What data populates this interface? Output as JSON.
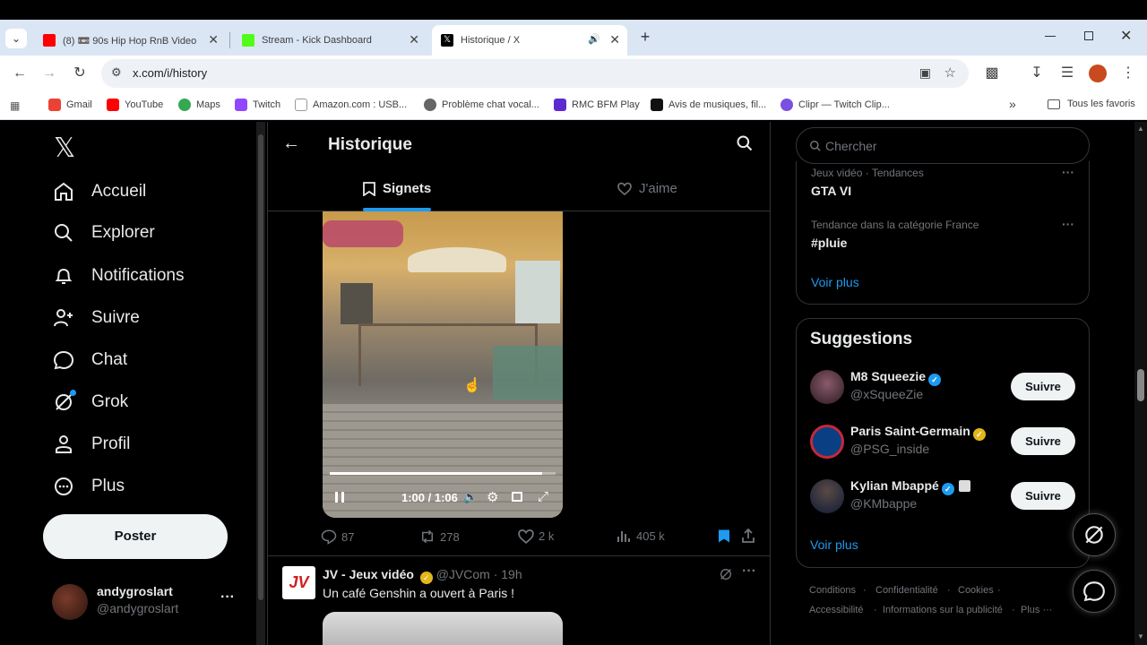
{
  "browser": {
    "tabs": [
      {
        "title": "(8) 📼 90s Hip Hop RnB Video",
        "close": "✕"
      },
      {
        "title": "Stream - Kick Dashboard",
        "close": "✕"
      },
      {
        "title": "Historique / X",
        "close": "✕"
      }
    ],
    "new_tab": "+",
    "url": "x.com/i/history",
    "bookmarks": [
      {
        "label": "Gmail",
        "color": "#ea4335"
      },
      {
        "label": "YouTube",
        "color": "#ff0000"
      },
      {
        "label": "Maps",
        "color": "#34a853"
      },
      {
        "label": "Twitch",
        "color": "#9146ff"
      },
      {
        "label": "Amazon.com : USB...",
        "color": "#222222"
      },
      {
        "label": "Problème chat vocal...",
        "color": "#555555"
      },
      {
        "label": "RMC BFM Play",
        "color": "#5b2bd1"
      },
      {
        "label": "Avis de musiques, fil...",
        "color": "#111111"
      },
      {
        "label": "Clipr — Twitch Clip...",
        "color": "#7b4fe0"
      }
    ],
    "bookmarks_more": "»",
    "all_bookmarks": "Tous les favoris"
  },
  "nav": {
    "items": [
      {
        "label": "Accueil",
        "icon": "home-icon"
      },
      {
        "label": "Explorer",
        "icon": "search-icon"
      },
      {
        "label": "Notifications",
        "icon": "bell-icon"
      },
      {
        "label": "Suivre",
        "icon": "person-add-icon"
      },
      {
        "label": "Chat",
        "icon": "chat-icon"
      },
      {
        "label": "Grok",
        "icon": "grok-icon"
      },
      {
        "label": "Profil",
        "icon": "profile-icon"
      },
      {
        "label": "Plus",
        "icon": "more-icon"
      }
    ],
    "post_button": "Poster",
    "account": {
      "name": "andygroslart",
      "handle": "@andygroslart",
      "more": "···"
    }
  },
  "main": {
    "title": "Historique",
    "tabs": [
      {
        "label": "Signets",
        "active": true
      },
      {
        "label": "J'aime",
        "active": false
      }
    ],
    "video": {
      "time": "1:00 / 1:06",
      "progress": 0.94
    },
    "actions": {
      "replies": "87",
      "reposts": "278",
      "likes": "2 k",
      "views": "405 k"
    },
    "next_post": {
      "author": "JV - Jeux vidéo",
      "handle": "@JVCom",
      "time": "· 19h",
      "text": "Un café Genshin a ouvert à Paris !",
      "avatar_text": "JV"
    }
  },
  "side": {
    "search_placeholder": "Chercher",
    "trends": [
      {
        "context": "Jeux vidéo · Tendances",
        "name": "GTA VI"
      },
      {
        "context": "Tendance dans la catégorie France",
        "name": "#pluie"
      }
    ],
    "trends_more": "Voir plus",
    "suggestions_title": "Suggestions",
    "suggestions": [
      {
        "name": "M8 Squeezie",
        "handle": "@xSqueeZie",
        "button": "Suivre",
        "badge": "blue"
      },
      {
        "name": "Paris Saint-Germain",
        "handle": "@PSG_inside",
        "button": "Suivre",
        "badge": "gold"
      },
      {
        "name": "Kylian Mbappé",
        "handle": "@KMbappe",
        "button": "Suivre",
        "badge": "blue"
      }
    ],
    "suggestions_more": "Voir plus",
    "footer": [
      "Conditions",
      "·",
      "Confidentialité",
      "·",
      "Cookies",
      "·",
      "Accessibilité",
      "·",
      "Informations sur la publicité",
      "·",
      "Plus ···"
    ]
  }
}
